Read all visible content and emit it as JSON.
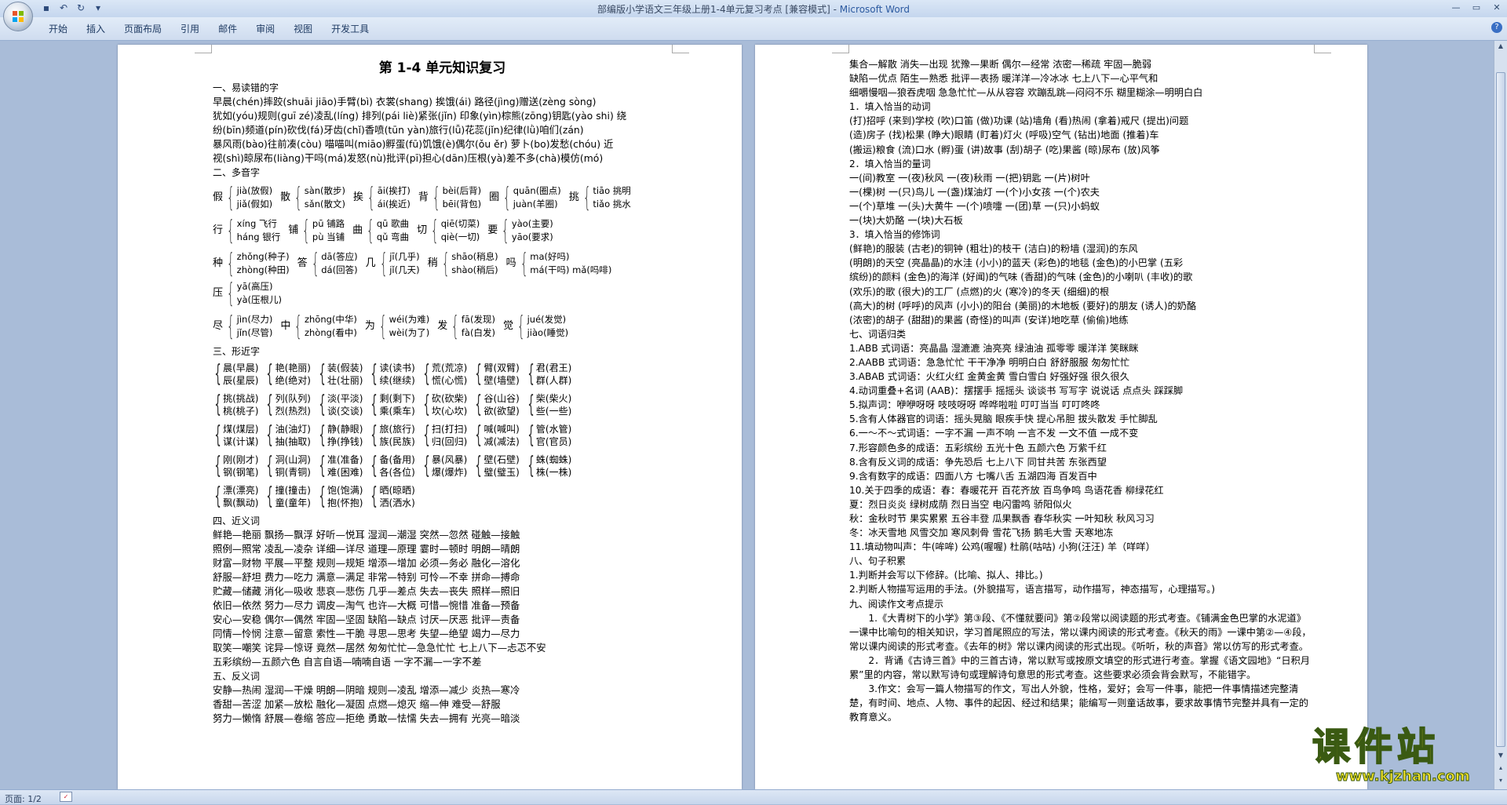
{
  "window": {
    "title_prefix": "部编版小学语文三年级上册1-4单元复习考点 [兼容模式] - ",
    "app_name": "Microsoft Word"
  },
  "ribbon": {
    "tabs": [
      "开始",
      "插入",
      "页面布局",
      "引用",
      "邮件",
      "审阅",
      "视图",
      "开发工具"
    ]
  },
  "status": {
    "page": "页面: 1/2"
  },
  "watermark": {
    "name": "课件站",
    "url": "www.kjzhan.com"
  },
  "page1": {
    "title": "第 1-4 单元知识复习",
    "s1": "一、易读错的字",
    "s1_lines": [
      "早晨(chén)摔跤(shuāi jiāo)手臂(bì) 衣裳(shang) 挨饿(ái) 路径(jìng)赠送(zèng sòng)",
      "犹如(yóu)规则(guī zé)凌乱(líng) 排列(pái liè)紧张(jǐn) 印象(yìn)棕熊(zōng)钥匙(yào shi)  绕",
      "纷(bīn)频道(pín)砍伐(fá)牙齿(chǐ)香喷(tūn yàn)旅行(lǚ)花蕊(jǐn)纪律(lǜ)咱们(zán)",
      "暴风雨(bào)往前凑(còu) 喵喵叫(miāo)孵蛋(fū)饥饿(è)偶尔(ǒu ěr) 萝卜(bo)发愁(chóu)   近",
      "视(shì)晾尿布(liàng)干吗(má)发怒(nù)批评(pī)担心(dān)压根(yà)差不多(chà)模仿(mó)"
    ],
    "s2": "二、多音字",
    "poly_rows": [
      [
        {
          "c": "假",
          "a": "jià(放假)",
          "b": "jiǎ(假如)"
        },
        {
          "c": "散",
          "a": "sàn(散步)",
          "b": "sǎn(散文)"
        },
        {
          "c": "挨",
          "a": "āi(挨打)",
          "b": "ái(挨近)"
        },
        {
          "c": "背",
          "a": "bèi(后背)",
          "b": "bēi(背包)"
        },
        {
          "c": "圈",
          "a": "quān(圈点)",
          "b": "juàn(羊圈)"
        },
        {
          "c": "挑",
          "a": "tiāo 挑明",
          "b": "tiǎo 挑水"
        }
      ],
      [
        {
          "c": "行",
          "a": "xíng 飞行",
          "b": "háng 银行"
        },
        {
          "c": "铺",
          "a": "pū 铺路",
          "b": "pù 当铺"
        },
        {
          "c": "曲",
          "a": "qū 歌曲",
          "b": "qǔ 弯曲"
        },
        {
          "c": "切",
          "a": "qiē(切菜)",
          "b": "qiè(一切)"
        },
        {
          "c": "要",
          "a": "yào(主要)",
          "b": "yāo(要求)"
        }
      ],
      [
        {
          "c": "种",
          "a": "zhǒng(种子)",
          "b": "zhòng(种田)"
        },
        {
          "c": "答",
          "a": "dā(答应)",
          "b": "dá(回答)"
        },
        {
          "c": "几",
          "a": "jī(几乎)",
          "b": "jǐ(几天)"
        },
        {
          "c": "稍",
          "a": "shāo(稍息)",
          "b": "shào(稍后)"
        },
        {
          "c": "吗",
          "a": "ma(好吗)",
          "b": "má(干吗) mǎ(吗啡)"
        },
        {
          "c": "压",
          "a": "yā(高压)",
          "b": "yà(压根儿)"
        }
      ],
      [
        {
          "c": "尽",
          "a": "jìn(尽力)",
          "b": "jǐn(尽管)"
        },
        {
          "c": "中",
          "a": "zhōng(中华)",
          "b": "zhòng(看中)"
        },
        {
          "c": "为",
          "a": "wéi(为难)",
          "b": "wèi(为了)"
        },
        {
          "c": "发",
          "a": "fā(发现)",
          "b": "fà(白发)"
        },
        {
          "c": "觉",
          "a": "jué(发觉)",
          "b": "jiào(睡觉)"
        }
      ]
    ],
    "s3": "三、形近字",
    "form_rows": [
      [
        [
          "晨(早晨)",
          "辰(星辰)"
        ],
        [
          "艳(艳丽)",
          "绝(绝对)"
        ],
        [
          "装(假装)",
          "壮(壮丽)"
        ],
        [
          "读(读书)",
          "续(继续)"
        ],
        [
          "荒(荒凉)",
          "慌(心慌)"
        ],
        [
          "臂(双臂)",
          "壁(墙壁)"
        ],
        [
          "君(君王)",
          "群(人群)"
        ]
      ],
      [
        [
          "挑(挑战)",
          "桃(桃子)"
        ],
        [
          "列(队列)",
          "烈(热烈)"
        ],
        [
          "淡(平淡)",
          "谈(交谈)"
        ],
        [
          "剩(剩下)",
          "乘(乘车)"
        ],
        [
          "砍(砍柴)",
          "坎(心坎)"
        ],
        [
          "谷(山谷)",
          "欲(欲望)"
        ],
        [
          "柴(柴火)",
          "些(一些)"
        ]
      ],
      [
        [
          "煤(煤层)",
          "谋(计谋)"
        ],
        [
          "油(油灯)",
          "抽(抽取)"
        ],
        [
          "静(静眼)",
          "挣(挣钱)"
        ],
        [
          "旅(旅行)",
          "族(民族)"
        ],
        [
          "扫(打扫)",
          "归(回归)"
        ],
        [
          "喊(喊叫)",
          "减(减法)"
        ],
        [
          "管(水管)",
          "官(官员)"
        ]
      ],
      [
        [
          "刚(刚才)",
          "钢(钢笔)"
        ],
        [
          "洞(山洞)",
          "铜(青铜)"
        ],
        [
          "准(准备)",
          "难(困难)"
        ],
        [
          "备(备用)",
          "各(各位)"
        ],
        [
          "暴(风暴)",
          "爆(爆炸)"
        ],
        [
          "壁(石壁)",
          "璧(璧玉)"
        ],
        [
          "蛛(蜘蛛)",
          "株(一株)"
        ]
      ],
      [
        [
          "漂(漂亮)",
          "飘(飘动)"
        ],
        [
          "撞(撞击)",
          "童(童年)"
        ],
        [
          "饱(饱满)",
          "抱(怀抱)"
        ],
        [
          "晒(晾晒)",
          "洒(洒水)"
        ]
      ]
    ],
    "s4": "四、近义词",
    "s4_lines": [
      "鲜艳—艳丽   飘扬—飘浮   好听—悦耳   湿润—潮湿   突然—忽然   碰触—接触",
      "照例—照常   凌乱—凌杂   详细—详尽   道理—原理   霎时—顿时   明朗—晴朗",
      "财富—财物   平展—平整   规则—规矩   增添—增加   必须—务必   融化—溶化",
      "舒服—舒坦   费力—吃力   满意—满足   非常—特别   可怜—不幸   拼命—搏命",
      "贮藏—储藏   消化—吸收   悲哀—悲伤   几乎—差点   失去—丧失   照样—照旧",
      "依旧—依然   努力—尽力   调皮—淘气   也许—大概   可惜—惋惜   准备—预备",
      "安心—安稳   偶尔—偶然   牢固—坚固   缺陷—缺点   讨厌—厌恶   批评—责备",
      "同情—怜悯   注意—留意   索性—干脆   寻思—思考   失望—绝望   竭力—尽力",
      "取笑—嘲笑   诧异—惊讶   竟然—居然   匆匆忙忙—急急忙忙   七上八下—忐忑不安",
      "五彩缤纷—五颜六色   自言自语—喃喃自语  一字不漏—一字不差"
    ],
    "s5": "五、反义词",
    "s5_lines": [
      "安静—热闹   湿润—干燥   明朗—阴暗   规则—凌乱    增添—减少   炎热—寒冷",
      "香甜—苦涩   加紧—放松   融化—凝固   点燃—熄灭    缩—伸       难受—舒服",
      "努力—懒惰   舒展—卷缩   答应—拒绝   勇敢—怯懦    失去—拥有   光亮—暗淡"
    ]
  },
  "page2": {
    "top_lines": [
      "集合—解散   消失—出现   犹豫—果断   偶尔—经常    浓密—稀疏   牢固—脆弱",
      "缺陷—优点   陌生—熟悉   批评—表扬   暖洋洋—冷冰冰   七上八下—心平气和",
      "细嚼慢咽—狼吞虎咽   急急忙忙—从从容容   欢蹦乱跳—闷闷不乐  糊里糊涂—明明白白"
    ],
    "s1": "1．填入恰当的动词",
    "s1_lines": [
      "(打)招呼 (来到)学校 (吹)口笛 (做)功课 (站)墙角   (看)热闹   (拿着)戒尺 (提出)问题",
      "(造)房子 (找)松果    (睁大)眼睛 (盯着)灯火   (呼吸)空气   (钻出)地面   (推着)车",
      "(搬运)粮食  (流)口水 (孵)蛋   (讲)故事   (刮)胡子    (吃)果酱   (晾)尿布   (放)风筝"
    ],
    "s2": "2．填入恰当的量词",
    "s2_lines": [
      "一(间)教室    一(夜)秋风      一(夜)秋雨      一(把)钥匙       一(片)树叶",
      "一(棵)树      一(只)鸟儿      一(盏)煤油灯    一(个)小女孩     一(个)农夫",
      "一(个)草堆    一(头)大黄牛    一(个)喷嚏      一(团)草         一(只)小蚂蚁",
      "一(块)大奶酪   一(块)大石板"
    ],
    "s3": "3．填入恰当的修饰词",
    "s3_lines": [
      "(鲜艳)的服装 (古老)的铜钟  (粗壮)的枝干  (洁白)的粉墙  (湿润)的东风",
      "(明朗)的天空  (亮晶晶)的水洼   (小小)的蓝天  (彩色)的地毯  (金色)的小巴掌    (五彩",
      "缤纷)的颜料   (金色)的海洋 (好闻)的气味   (香甜)的气味   (金色)的小喇叭   (丰收)的歌",
      "(欢乐)的歌   (很大)的工厂   (点燃)的火   (寒冷)的冬天   (细细)的根",
      "(高大)的树   (呼呼)的风声   (小小)的阳台 (美丽)的木地板  (要好)的朋友  (诱人)的奶酪",
      "(浓密)的胡子 (甜甜)的果酱   (奇怪)的叫声   (安详)地吃草   (偷偷)地练"
    ],
    "s7": "七、词语归类",
    "s7_lines": [
      "1.ABB 式词语：亮晶晶  湿漉漉  油亮亮    绿油油  孤零零  暖洋洋  笑眯眯",
      "2.AABB 式词语：急急忙忙   干干净净   明明白白   舒舒服服      匆匆忙忙",
      "3.ABAB 式词语：火红火红   金黄金黄     雪白雪白   好强好强  很久很久",
      "4.动词重叠+名词 (AAB)：摆摆手  摇摇头  谈谈书   写写字  说说话    点点头   踩踩脚",
      "5.拟声词：咿咿呀呀   吱吱呀呀     哗哗啦啦   叮叮当当   叮叮咚咚",
      "5.含有人体器官的词语：摇头晃脑   眼疾手快   提心吊胆   拔头散发   手忙脚乱",
      "6.一～不～式词语：一字不漏   一声不响   一言不发  一文不值    一成不变",
      "7.形容颜色多的成语：五彩缤纷   五光十色    五颜六色    万紫千红",
      "8.含有反义词的成语：争先恐后   七上八下     同甘共苦    东张西望",
      "9.含有数字的成语：四面八方   七嘴八舌   五湖四海    百发百中",
      "10.关于四季的成语：春：春暖花开  百花齐放   百鸟争鸣   鸟语花香   柳绿花红",
      "夏：烈日炎炎   绿树成荫   烈日当空   电闪雷鸣   骄阳似火",
      "秋：金秋时节   果实累累   五谷丰登   瓜果飘香    春华秋实   一叶知秋    秋风习习",
      "冬：冰天雪地   风雪交加   寒风刺骨   雪花飞扬    鹅毛大雪    天寒地冻",
      "11.填动物叫声：牛(哞哞)  公鸡(喔喔)   杜鹃(咕咕)  小狗(汪汪) 羊（咩咩）"
    ],
    "s8": "八、句子积累",
    "s8_lines": [
      "1.判断并会写以下修辞。(比喻、拟人、排比。)",
      "2.判断人物描写运用的手法。(外貌描写，语言描写，动作描写，神态描写，心理描写。)"
    ],
    "s9": "九、阅读作文考点提示",
    "s9_paras": [
      "1.《大青树下的小学》第③段、《不懂就要问》第②段常以阅读题的形式考查。《铺满金色巴掌的水泥道》一课中比喻句的相关知识，学习首尾照应的写法，常以课内阅读的形式考查。《秋天的雨》一课中第②—④段，常以课内阅读的形式考查。《去年的树》常以课内阅读的形式出现。《听听，秋的声音》常以仿写的形式考查。",
      "2．背诵《古诗三首》中的三首古诗，常以默写或按原文填空的形式进行考查。掌握《语文园地》“日积月累”里的内容，常以默写诗句或理解诗句意思的形式考查。这些要求必须会背会默写，不能错字。",
      "3.作文：会写一篇人物描写的作文，写出人外貌，性格，爱好；会写一件事，能把一件事情描述完整清楚，有时间、地点、人物、事件的起因、经过和结果；能编写一则童话故事，要求故事情节完整并具有一定的教育意义。"
    ]
  }
}
